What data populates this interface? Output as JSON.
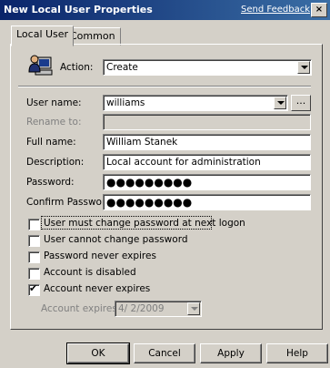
{
  "window": {
    "title": "New Local User Properties",
    "feedback_link": "Send Feedback",
    "close_glyph": "×"
  },
  "tabs": [
    {
      "label": "Local User"
    },
    {
      "label": "Common"
    }
  ],
  "action": {
    "label": "Action:",
    "value": "Create"
  },
  "fields": {
    "username": {
      "label": "User name:",
      "value": "williams",
      "browse": "..."
    },
    "rename": {
      "label": "Rename to:",
      "value": ""
    },
    "fullname": {
      "label": "Full name:",
      "value": "William Stanek"
    },
    "description": {
      "label": "Description:",
      "value": "Local account for administration"
    },
    "password": {
      "label": "Password:",
      "value": "●●●●●●●●●"
    },
    "confirm": {
      "label": "Confirm Password:",
      "value": "●●●●●●●●●"
    }
  },
  "options": [
    {
      "label": "User must change password at next logon",
      "checked": false
    },
    {
      "label": "User cannot change password",
      "checked": false
    },
    {
      "label": "Password never expires",
      "checked": false
    },
    {
      "label": "Account is disabled",
      "checked": false
    },
    {
      "label": "Account never expires",
      "checked": true
    }
  ],
  "expires": {
    "label": "Account expires:",
    "value": "4/  2/2009"
  },
  "buttons": {
    "ok": "OK",
    "cancel": "Cancel",
    "apply": "Apply",
    "help": "Help"
  },
  "check_glyph": "✔"
}
